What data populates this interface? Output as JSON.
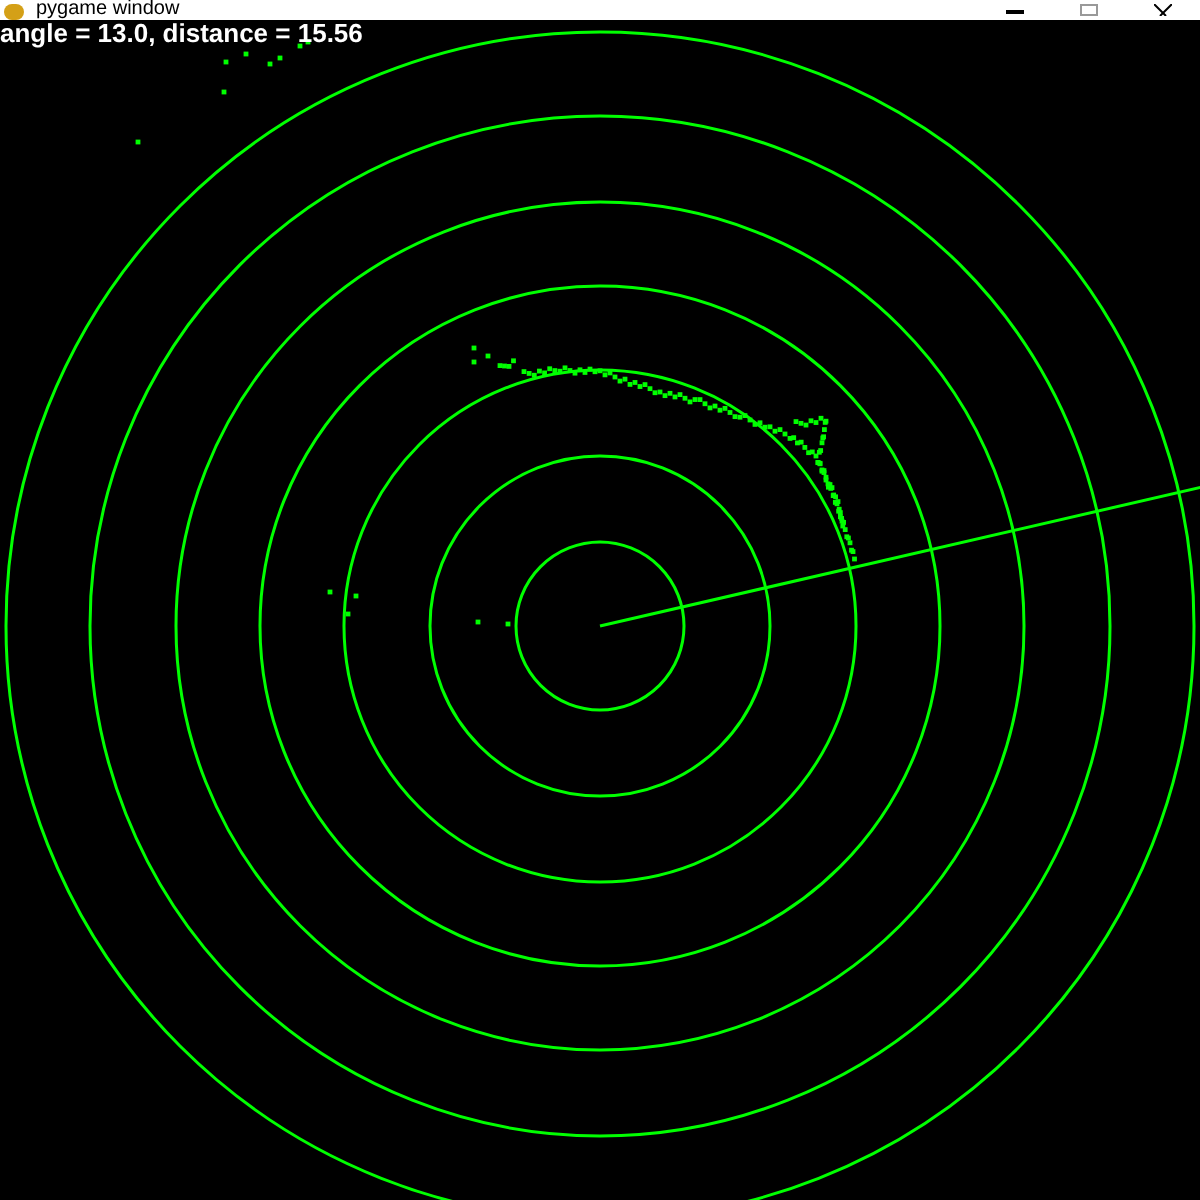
{
  "window": {
    "title": "pygame window"
  },
  "readout": "angle = 13.0, distance = 15.56"
}
